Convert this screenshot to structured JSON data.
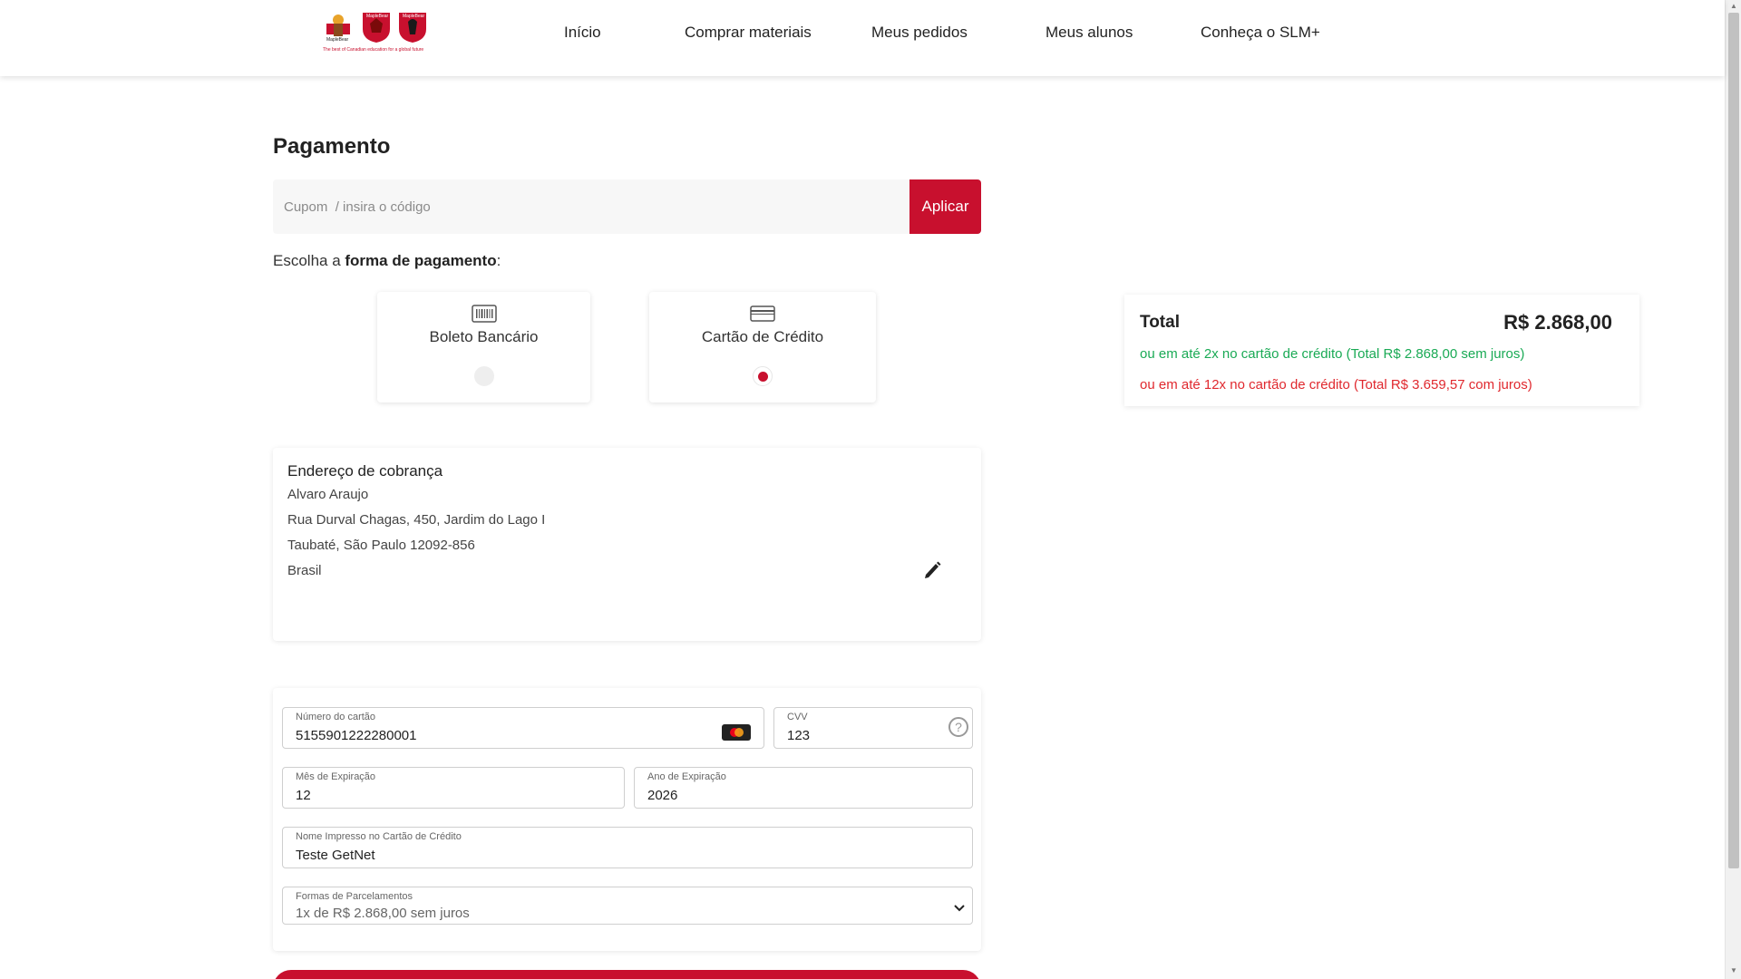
{
  "header": {
    "logo_alt": "Maple Bear",
    "logo_tagline": "The best of Canadian education for a global future",
    "nav": [
      {
        "label": "Início"
      },
      {
        "label": "Comprar materiais"
      },
      {
        "label": "Meus pedidos"
      },
      {
        "label": "Meus alunos"
      },
      {
        "label": "Conheça o SLM+"
      }
    ]
  },
  "page": {
    "title": "Pagamento"
  },
  "coupon": {
    "placeholder": "Cupom  / insira o código",
    "button_label": "Aplicar"
  },
  "payment_choice": {
    "prefix": "Escolha a ",
    "bold": "forma de pagamento",
    "suffix": ":",
    "options": [
      {
        "label": "Boleto Bancário",
        "icon": "barcode-icon",
        "selected": false
      },
      {
        "label": "Cartão de Crédito",
        "icon": "credit-card-icon",
        "selected": true
      }
    ]
  },
  "summary": {
    "total_label": "Total",
    "total_value": "R$ 2.868,00",
    "installments_no_interest": "ou em até 2x no cartão de crédito (Total R$ 2.868,00 sem juros)",
    "installments_with_interest": "ou em até 12x no cartão de crédito (Total R$ 3.659,57 com juros)"
  },
  "billing_address": {
    "title": "Endereço de cobrança",
    "lines": [
      "Alvaro Araujo",
      "Rua Durval Chagas, 450, Jardim do Lago I",
      "Taubaté, São Paulo 12092-856",
      "Brasil"
    ]
  },
  "card_form": {
    "number_label": "Número do cartão",
    "number_value": "5155901222280001",
    "cvv_label": "CVV",
    "cvv_value": "123",
    "month_label": "Mês de Expiração",
    "month_value": "12",
    "year_label": "Ano de Expiração",
    "year_value": "2026",
    "name_label": "Nome Impresso no Cartão de Crédito",
    "name_value": "Teste GetNet",
    "installments_label": "Formas de Parcelamentos",
    "installments_value": "1x de R$ 2.868,00 sem juros"
  },
  "colors": {
    "brand_red": "#c8102e",
    "green": "#1aaa55",
    "red_text": "#e0282e"
  }
}
